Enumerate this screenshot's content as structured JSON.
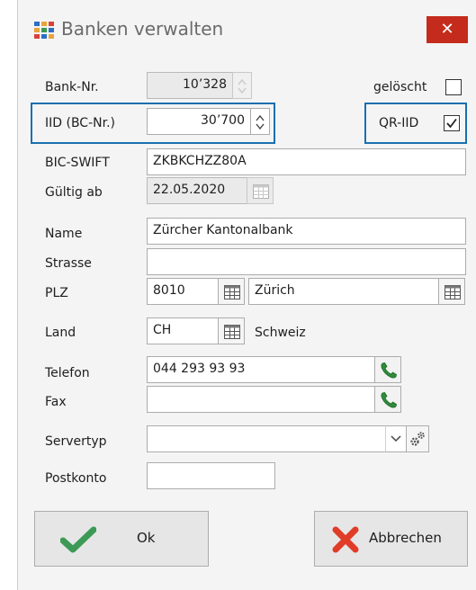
{
  "window": {
    "title": "Banken verwalten",
    "close_symbol": "✕"
  },
  "form": {
    "bank_nr": {
      "label": "Bank-Nr.",
      "value": "10’328"
    },
    "geloescht": {
      "label": "gelöscht",
      "checked": false
    },
    "iid": {
      "label": "IID (BC-Nr.)",
      "value": "30’700"
    },
    "qr_iid": {
      "label": "QR-IID",
      "checked": true
    },
    "bic": {
      "label": "BIC-SWIFT",
      "value": "ZKBKCHZZ80A"
    },
    "gueltig_ab": {
      "label": "Gültig ab",
      "value": "22.05.2020"
    },
    "name": {
      "label": "Name",
      "value": "Zürcher Kantonalbank"
    },
    "strasse": {
      "label": "Strasse",
      "value": ""
    },
    "plz": {
      "label": "PLZ",
      "value": "8010",
      "ort": "Zürich"
    },
    "land": {
      "label": "Land",
      "code": "CH",
      "name": "Schweiz"
    },
    "telefon": {
      "label": "Telefon",
      "value": "044 293 93 93"
    },
    "fax": {
      "label": "Fax",
      "value": ""
    },
    "servertyp": {
      "label": "Servertyp",
      "value": ""
    },
    "postkonto": {
      "label": "Postkonto",
      "value": ""
    }
  },
  "buttons": {
    "ok": "Ok",
    "cancel": "Abbrechen"
  },
  "colors": {
    "highlight": "#1a6fb0",
    "close": "#c42b1c",
    "ok_check": "#3c9a56",
    "cancel_x": "#e03c28",
    "phone": "#2e8b3a"
  }
}
